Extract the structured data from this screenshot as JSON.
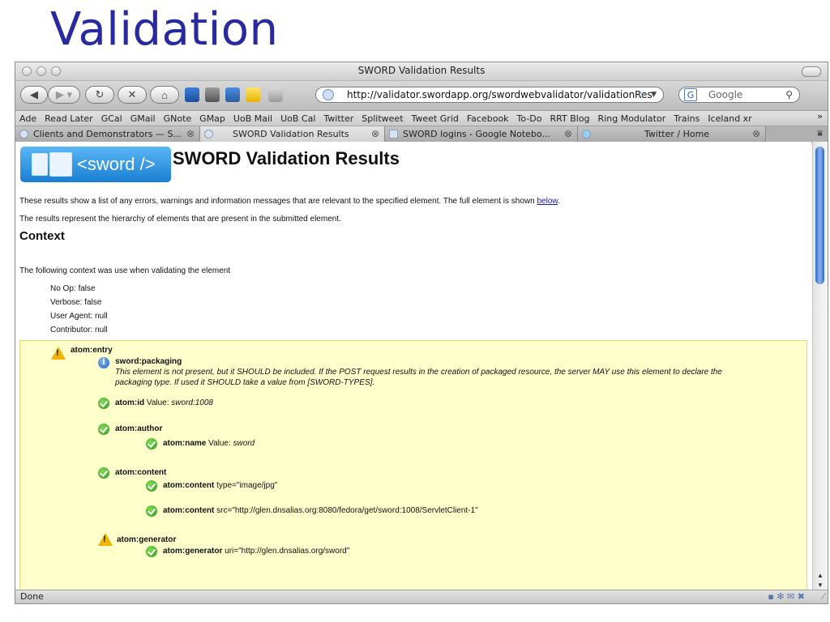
{
  "slide": {
    "title": "Validation"
  },
  "window": {
    "title": "SWORD Validation Results"
  },
  "toolbar": {
    "url": "http://validator.swordapp.org/swordwebvalidator/validationRes",
    "search_placeholder": "Google"
  },
  "bookmarks": [
    "Ade",
    "Read Later",
    "GCal",
    "GMail",
    "GNote",
    "GMap",
    "UoB Mail",
    "UoB Cal",
    "Twitter",
    "Splitweet",
    "Tweet Grid",
    "Facebook",
    "To-Do",
    "RRT Blog",
    "Ring Modulator",
    "Trains",
    "Iceland xr"
  ],
  "tabs": [
    {
      "label": "Clients and Demonstrators — S..."
    },
    {
      "label": "SWORD Validation Results"
    },
    {
      "label": "SWORD logins - Google Notebo..."
    },
    {
      "label": "Twitter / Home"
    }
  ],
  "page": {
    "logo_text": "<sword />",
    "heading": "SWORD Validation Results",
    "intro_prefix": "These results show a list of any errors, warnings and information messages that are relevant to the specified element. The full element is shown ",
    "intro_link": "below",
    "intro_suffix": ".",
    "hierarchy_note": "The results represent the hierarchy of elements that are present in the submitted element.",
    "context_heading": "Context",
    "context_intro": "The following context was use when validating the element",
    "context_items": [
      "No Op: false",
      "Verbose: false",
      "User Agent: null",
      "Contributor: null"
    ]
  },
  "results": {
    "entry": "atom:entry",
    "packaging": {
      "name": "sword:packaging",
      "message_line1": "This element is not present, but it SHOULD be included. If the POST request results in the creation of packaged resource, the server MAY use this element to declare the",
      "message_line2": "packaging type. If used it SHOULD take a value from [SWORD-TYPES]."
    },
    "id": {
      "name": "atom:id",
      "label": "Value:",
      "value": "sword:1008"
    },
    "author": {
      "name": "atom:author"
    },
    "author_name": {
      "name": "atom:name",
      "label": "Value:",
      "value": "sword"
    },
    "content": {
      "name": "atom:content"
    },
    "content_type": {
      "name": "atom:content",
      "attr": "type=\"image/jpg\""
    },
    "content_src": {
      "name": "atom:content",
      "attr": "src=\"http://glen.dnsalias.org:8080/fedora/get/sword:1008/ServletClient-1\""
    },
    "generator": {
      "name": "atom:generator"
    },
    "generator_uri": {
      "name": "atom:generator",
      "attr": "uri=\"http://glen.dnsalias.org/sword\""
    }
  },
  "status": {
    "text": "Done"
  },
  "colors": {
    "slide_title": "#2a2aa0",
    "panel_bg": "#ffffcc",
    "ok": "#2f9a17",
    "warn": "#f0b400",
    "info": "#1f66c6"
  }
}
